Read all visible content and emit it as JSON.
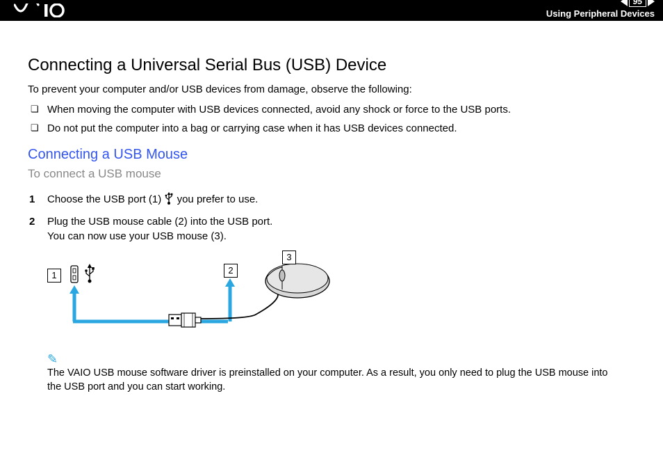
{
  "header": {
    "page_number": "95",
    "section": "Using Peripheral Devices"
  },
  "title": "Connecting a Universal Serial Bus (USB) Device",
  "intro": "To prevent your computer and/or USB devices from damage, observe the following:",
  "bullets": [
    "When moving the computer with USB devices connected, avoid any shock or force to the USB ports.",
    "Do not put the computer into a bag or carrying case when it has USB devices connected."
  ],
  "subtitle": "Connecting a USB Mouse",
  "subheading": "To connect a USB mouse",
  "steps": [
    {
      "pre": "Choose the USB port (1) ",
      "post": " you prefer to use."
    },
    {
      "pre": "Plug the USB mouse cable (2) into the USB port.",
      "post2": "You can now use your USB mouse (3)."
    }
  ],
  "callouts": {
    "c1": "1",
    "c2": "2",
    "c3": "3"
  },
  "note": "The VAIO USB mouse software driver is preinstalled on your computer. As a result, you only need to plug the USB mouse into the USB port and you can start working."
}
